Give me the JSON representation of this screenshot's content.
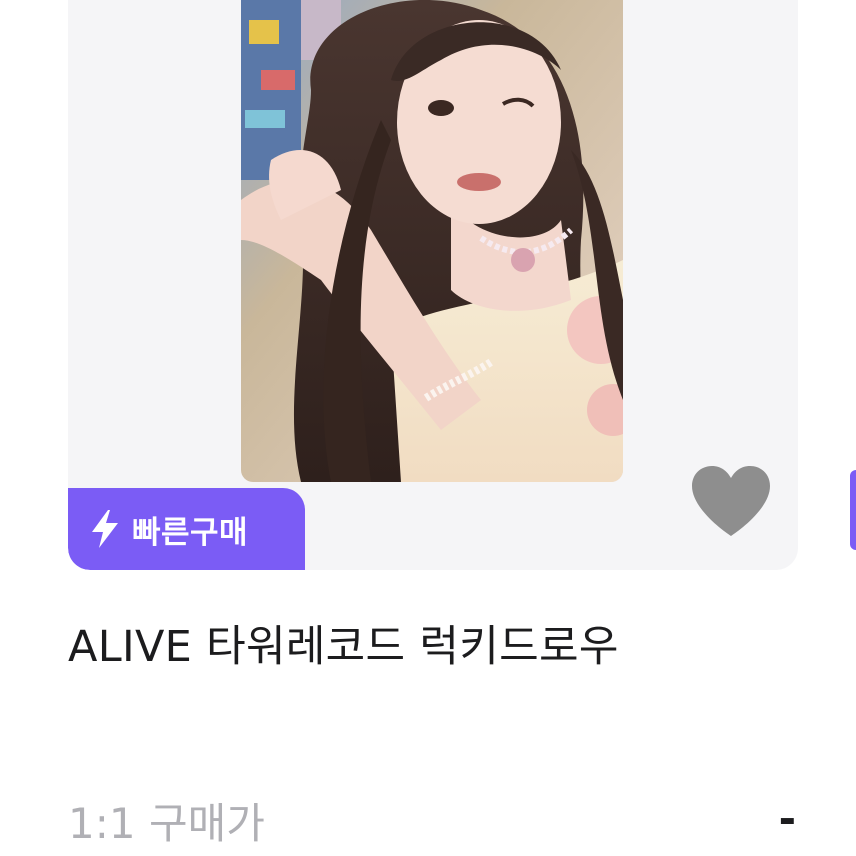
{
  "product": {
    "image_alt": "photocard",
    "badge_label": "빠른구매",
    "badge_icon": "lightning-bolt-icon",
    "favorite_icon": "heart-icon",
    "title": "ALIVE 타워레코드 럭키드로우"
  },
  "price": {
    "label": "1:1 구매가",
    "value": "-"
  },
  "colors": {
    "accent": "#7b5cf5",
    "card_background": "#f5f5f7",
    "heart": "#8e8e8e",
    "title_text": "#1c1c1e",
    "muted_text": "#b0b0b5"
  }
}
